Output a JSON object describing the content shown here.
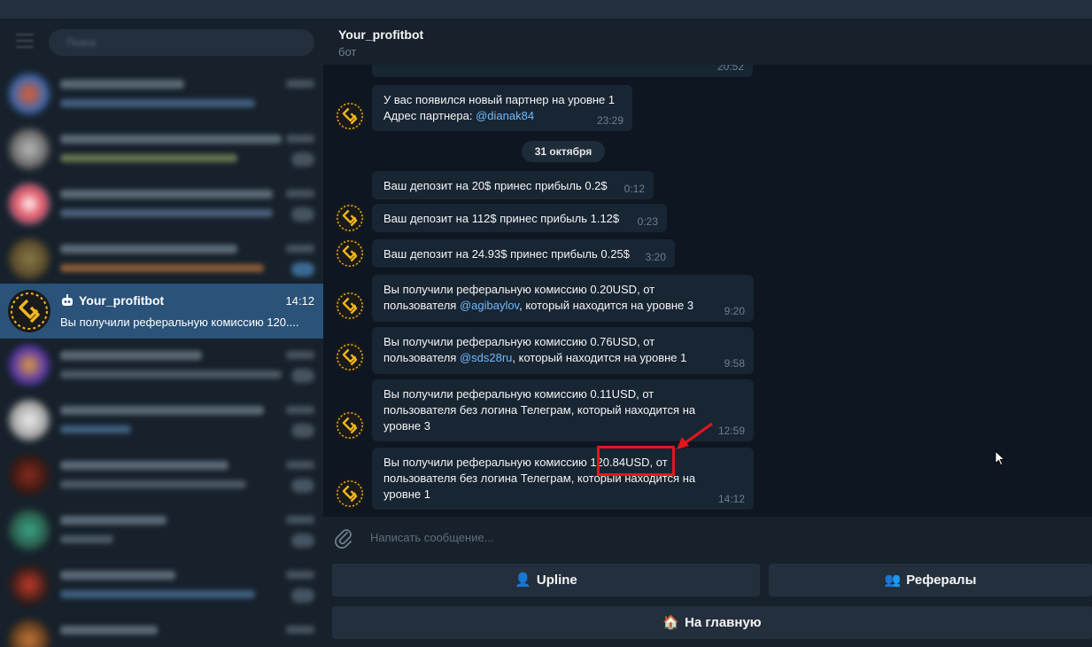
{
  "sidebar": {
    "search_placeholder": "Поиск",
    "active_chat": {
      "name": "Your_profitbot",
      "time": "14:12",
      "preview": "Вы получили реферальную комиссию 120...."
    }
  },
  "header": {
    "title": "Your_profitbot",
    "subtitle": "бот"
  },
  "messages": {
    "partial_time": "20:52",
    "partner_line1": "У вас появился новый партнер на уровне 1",
    "partner_line2_prefix": "Адрес партнера: ",
    "partner_link": "@dianak84",
    "partner_time": "23:29",
    "date_separator": "31 октября",
    "deposit1_text": "Ваш депозит на 20$ принес прибыль 0.2$",
    "deposit1_time": "0:12",
    "deposit2_text": "Ваш депозит на 112$ принес прибыль 1.12$",
    "deposit2_time": "0:23",
    "deposit3_text": "Ваш депозит на 24.93$ принес прибыль 0.25$",
    "deposit3_time": "3:20",
    "ref1_line1": "Вы получили реферальную комиссию 0.20USD, от",
    "ref1_prefix": "пользователя ",
    "ref1_link": "@agibaylov",
    "ref1_suffix": ", который находится на уровне 3",
    "ref1_time": "9:20",
    "ref2_line1": "Вы получили реферальную комиссию 0.76USD, от",
    "ref2_prefix": "пользователя ",
    "ref2_link": "@sds28ru",
    "ref2_suffix": ", который находится на уровне 1",
    "ref2_time": "9:58",
    "ref3_line1": "Вы получили реферальную комиссию 0.11USD, от",
    "ref3_line2": "пользователя без логина Телеграм, который находится на",
    "ref3_line3": "уровне 3",
    "ref3_time": "12:59",
    "ref4_line1": "Вы получили реферальную комиссию 120.84USD, от",
    "ref4_line2": "пользователя без логина Телеграм, который находится на",
    "ref4_line3": "уровне 1",
    "ref4_time": "14:12"
  },
  "composer": {
    "placeholder": "Написать сообщение..."
  },
  "keyboard": {
    "upline_icon": "👤",
    "upline_label": "Upline",
    "referrals_icon": "👥",
    "referrals_label": "Рефералы",
    "home_icon": "🏠",
    "home_label": "На главную"
  },
  "colors": {
    "accent_active": "#2b5278",
    "link": "#71baf9",
    "highlight": "#e4151c",
    "logo_gold": "#f2b620"
  }
}
